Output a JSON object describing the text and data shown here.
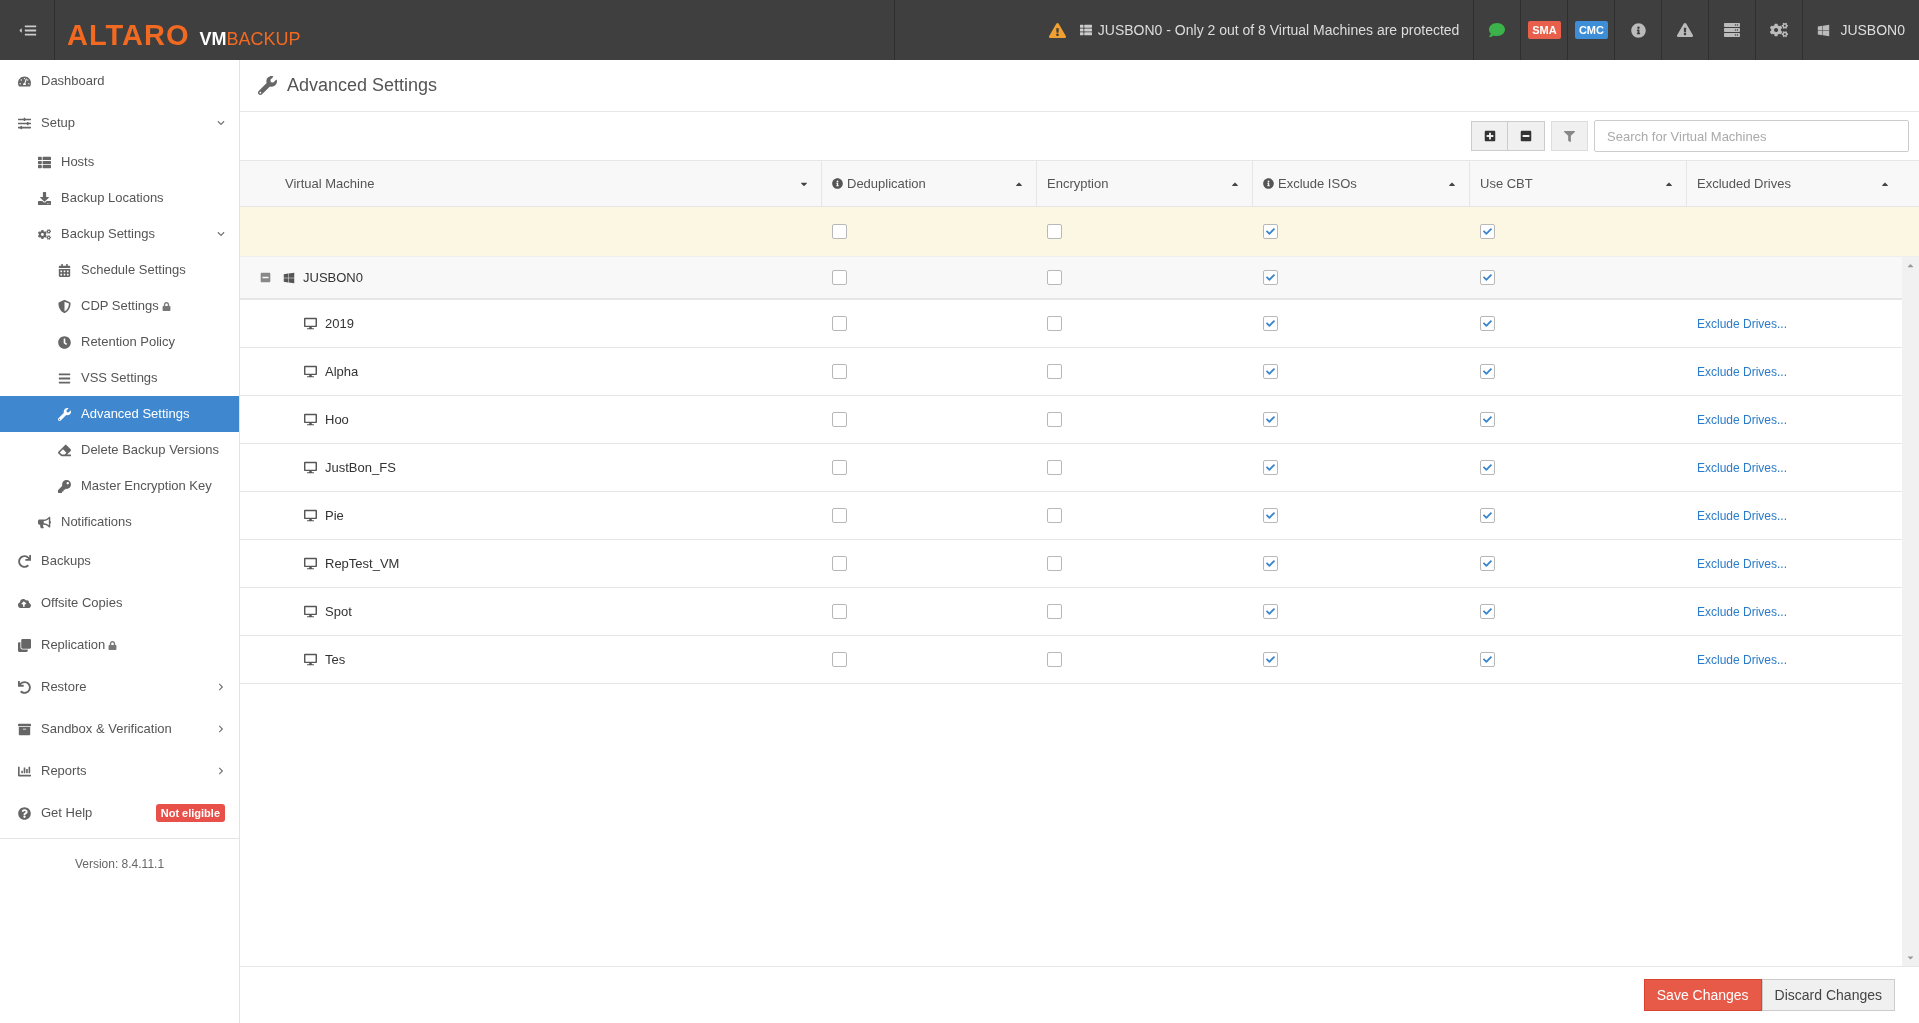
{
  "top_bar": {
    "logo": {
      "brand": "ALTARO",
      "product": "VM",
      "product_suffix": "BACKUP"
    },
    "alert": "JUSBON0 - Only 2 out of 8 Virtual Machines are protected",
    "badges": [
      {
        "label": "SMA",
        "color": "#e8604c"
      },
      {
        "label": "CMC",
        "color": "#3d8ed6"
      }
    ],
    "user": "JUSBON0"
  },
  "sidebar": {
    "items": [
      {
        "label": "Dashboard",
        "selected": false
      },
      {
        "label": "Setup",
        "selected": false,
        "expanded": true,
        "children": [
          {
            "label": "Hosts",
            "selected": false
          },
          {
            "label": "Backup Locations",
            "selected": false
          },
          {
            "label": "Backup Settings",
            "selected": false,
            "expanded": true,
            "children": [
              {
                "label": "Schedule Settings",
                "selected": false
              },
              {
                "label": "CDP Settings",
                "selected": false,
                "locked": true
              },
              {
                "label": "Retention Policy",
                "selected": false
              },
              {
                "label": "VSS Settings",
                "selected": false
              },
              {
                "label": "Advanced Settings",
                "selected": true
              },
              {
                "label": "Delete Backup Versions",
                "selected": false
              },
              {
                "label": "Master Encryption Key",
                "selected": false
              }
            ]
          },
          {
            "label": "Notifications",
            "selected": false
          }
        ]
      },
      {
        "label": "Backups",
        "selected": false
      },
      {
        "label": "Offsite Copies",
        "selected": false
      },
      {
        "label": "Replication",
        "selected": false,
        "locked": true
      },
      {
        "label": "Restore",
        "selected": false,
        "expanded": false
      },
      {
        "label": "Sandbox & Verification",
        "selected": false,
        "expanded": false
      },
      {
        "label": "Reports",
        "selected": false,
        "expanded": false
      },
      {
        "label": "Get Help",
        "selected": false,
        "badge": "Not eligible"
      }
    ],
    "version": "Version: 8.4.11.1"
  },
  "page": {
    "title": "Advanced Settings"
  },
  "search": {
    "placeholder": "Search for Virtual Machines"
  },
  "table": {
    "columns": [
      {
        "label": "Virtual Machine",
        "sort_ascending": false,
        "info": false
      },
      {
        "label": "Deduplication",
        "sort_ascending": true,
        "info": true
      },
      {
        "label": "Encryption",
        "sort_ascending": true,
        "info": false
      },
      {
        "label": "Exclude ISOs",
        "sort_ascending": true,
        "info": true
      },
      {
        "label": "Use CBT",
        "sort_ascending": true,
        "info": false
      },
      {
        "label": "Excluded Drives",
        "sort_ascending": true,
        "info": false
      }
    ],
    "rows": [
      {
        "kind": "defaults",
        "deduplication": false,
        "encryption": false,
        "exclude_isos": true,
        "use_cbt": true
      },
      {
        "kind": "host",
        "name": "JUSBON0",
        "expanded": true,
        "deduplication": false,
        "encryption": false,
        "exclude_isos": true,
        "use_cbt": true
      },
      {
        "kind": "vm",
        "name": "2019",
        "deduplication": false,
        "encryption": false,
        "exclude_isos": true,
        "use_cbt": true,
        "link": "Exclude Drives..."
      },
      {
        "kind": "vm",
        "name": "Alpha",
        "deduplication": false,
        "encryption": false,
        "exclude_isos": true,
        "use_cbt": true,
        "link": "Exclude Drives..."
      },
      {
        "kind": "vm",
        "name": "Hoo",
        "deduplication": false,
        "encryption": false,
        "exclude_isos": true,
        "use_cbt": true,
        "link": "Exclude Drives..."
      },
      {
        "kind": "vm",
        "name": "JustBon_FS",
        "deduplication": false,
        "encryption": false,
        "exclude_isos": true,
        "use_cbt": true,
        "link": "Exclude Drives..."
      },
      {
        "kind": "vm",
        "name": "Pie",
        "deduplication": false,
        "encryption": false,
        "exclude_isos": true,
        "use_cbt": true,
        "link": "Exclude Drives..."
      },
      {
        "kind": "vm",
        "name": "RepTest_VM",
        "deduplication": false,
        "encryption": false,
        "exclude_isos": true,
        "use_cbt": true,
        "link": "Exclude Drives..."
      },
      {
        "kind": "vm",
        "name": "Spot",
        "deduplication": false,
        "encryption": false,
        "exclude_isos": true,
        "use_cbt": true,
        "link": "Exclude Drives..."
      },
      {
        "kind": "vm",
        "name": "Tes",
        "deduplication": false,
        "encryption": false,
        "exclude_isos": true,
        "use_cbt": true,
        "link": "Exclude Drives..."
      }
    ]
  },
  "buttons": [
    {
      "label": "Save Changes",
      "kind": "primary"
    },
    {
      "label": "Discard Changes",
      "kind": "secondary"
    }
  ]
}
